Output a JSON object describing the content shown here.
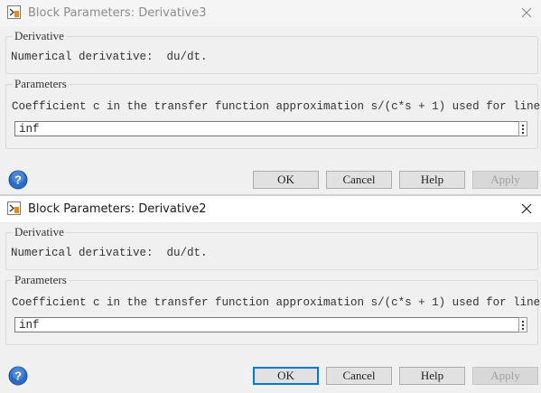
{
  "dialogs": {
    "top": {
      "title": "Block Parameters: Derivative3",
      "description_group": {
        "legend": "Derivative",
        "text": "Numerical derivative:  du/dt."
      },
      "parameters_group": {
        "legend": "Parameters",
        "coefficient_label": "Coefficient c in the transfer function approximation s/(c*s + 1) used for linearization:",
        "coefficient_value": "inf"
      },
      "buttons": {
        "ok": "OK",
        "cancel": "Cancel",
        "help": "Help",
        "apply": "Apply"
      }
    },
    "bottom": {
      "title": "Block Parameters: Derivative2",
      "description_group": {
        "legend": "Derivative",
        "text": "Numerical derivative:  du/dt."
      },
      "parameters_group": {
        "legend": "Parameters",
        "coefficient_label": "Coefficient c in the transfer function approximation s/(c*s + 1) used for linearization:",
        "coefficient_value": "inf"
      },
      "buttons": {
        "ok": "OK",
        "cancel": "Cancel",
        "help": "Help",
        "apply": "Apply"
      }
    }
  },
  "colors": {
    "window_bg": "#f0f0f0",
    "focus_border": "#0078d7",
    "help_icon_blue": "#2b6cc4"
  },
  "icons": [
    "simulink-block-icon",
    "close-icon",
    "help-icon",
    "kebab-menu-icon"
  ]
}
